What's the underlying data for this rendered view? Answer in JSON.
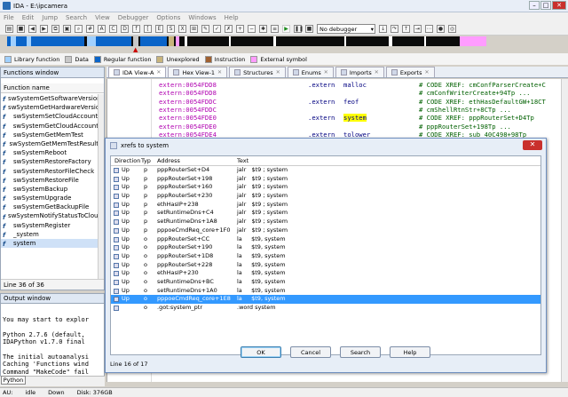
{
  "window": {
    "title": "IDA - E:\\ipcamera"
  },
  "menu": [
    "File",
    "Edit",
    "Jump",
    "Search",
    "View",
    "Debugger",
    "Options",
    "Windows",
    "Help"
  ],
  "toolbar": {
    "debugger_select": "No debugger"
  },
  "legend": [
    {
      "label": "Library function",
      "color": "#a0d0ff"
    },
    {
      "label": "Data",
      "color": "#c8c8c8"
    },
    {
      "label": "Regular function",
      "color": "#0a64c8"
    },
    {
      "label": "Unexplored",
      "color": "#c8b47c"
    },
    {
      "label": "Instruction",
      "color": "#a06030"
    },
    {
      "label": "External symbol",
      "color": "#ff9cff"
    }
  ],
  "functions_window": {
    "title": "Functions window",
    "column": "Function name",
    "items": [
      "swSystemGetSoftwareVersion",
      "swSystemGetHardwareVersion",
      "swSystemSetCloudAccount",
      "swSystemGetCloudAccount",
      "swSystemGetMemTest",
      "swSystemGetMemTestResult",
      "swSystemReboot",
      "swSystemRestoreFactory",
      "swSystemRestorFileCheck",
      "swSystemRestoreFile",
      "swSystemBackup",
      "swSystemUpgrade",
      "swSystemGetBackupFile",
      "swSystemNotifyStatusToCloud",
      "swSystemRegister",
      "_system",
      "system"
    ],
    "status": "Line 36 of 36"
  },
  "output_window": {
    "title": "Output window",
    "lines": [
      "You may start to explor",
      "",
      "Python 2.7.6 (default,",
      "IDAPython v1.7.0 final",
      "",
      "The initial autoanalysi",
      "Caching 'Functions wind",
      "Command \"MakeCode\" fail"
    ],
    "python_button": "Python"
  },
  "tabs": [
    "IDA View-A",
    "Hex View-1",
    "Structures",
    "Enums",
    "Imports",
    "Exports"
  ],
  "disasm": [
    {
      "addr": "extern:0054FDD8",
      "ins": ".extern",
      "op": "malloc",
      "comment": "# CODE XREF: cmConfParserCreate+C"
    },
    {
      "addr": "extern:0054FDD8",
      "ins": "",
      "op": "",
      "comment": "# cmConfWriterCreate+94Tp ..."
    },
    {
      "addr": "extern:0054FDDC",
      "ins": ".extern",
      "op": "feof",
      "comment": "# CODE XREF: ethHasDefaultGW+18CT"
    },
    {
      "addr": "extern:0054FDDC",
      "ins": "",
      "op": "",
      "comment": "# cmShellRtnStr+8CTp ..."
    },
    {
      "addr": "extern:0054FDE0",
      "ins": ".extern",
      "op": "system",
      "comment": "# CODE XREF: pppRouterSet+D4Tp"
    },
    {
      "addr": "extern:0054FDE0",
      "ins": "",
      "op": "",
      "comment": "# pppRouterSet+198Tp ..."
    },
    {
      "addr": "extern:0054FDE4",
      "ins": ".extern",
      "op": "tolower",
      "comment": "# CODE XREF: sub_40C498+98Tp"
    }
  ],
  "xrefs_dialog": {
    "title": "xrefs to system",
    "columns": [
      "Direction",
      "Typ",
      "Address",
      "Text"
    ],
    "rows": [
      {
        "dir": "Up",
        "typ": "p",
        "addr": "pppRouterSet+D4",
        "text": "jalr   $t9 ; system"
      },
      {
        "dir": "Up",
        "typ": "p",
        "addr": "pppRouterSet+198",
        "text": "jalr   $t9 ; system"
      },
      {
        "dir": "Up",
        "typ": "p",
        "addr": "pppRouterSet+160",
        "text": "jalr   $t9 ; system"
      },
      {
        "dir": "Up",
        "typ": "p",
        "addr": "pppRouterSet+230",
        "text": "jalr   $t9 ; system"
      },
      {
        "dir": "Up",
        "typ": "p",
        "addr": "ethHasIP+238",
        "text": "jalr   $t9 ; system"
      },
      {
        "dir": "Up",
        "typ": "p",
        "addr": "setRuntimeDns+C4",
        "text": "jalr   $t9 ; system"
      },
      {
        "dir": "Up",
        "typ": "p",
        "addr": "setRuntimeDns+1A8",
        "text": "jalr   $t9 ; system"
      },
      {
        "dir": "Up",
        "typ": "p",
        "addr": "pppoeCmdReq_core+1F0",
        "text": "jalr   $t9 ; system"
      },
      {
        "dir": "Up",
        "typ": "o",
        "addr": "pppRouterSet+CC",
        "text": "la     $t9, system"
      },
      {
        "dir": "Up",
        "typ": "o",
        "addr": "pppRouterSet+190",
        "text": "la     $t9, system"
      },
      {
        "dir": "Up",
        "typ": "o",
        "addr": "pppRouterSet+1D8",
        "text": "la     $t9, system"
      },
      {
        "dir": "Up",
        "typ": "o",
        "addr": "pppRouterSet+228",
        "text": "la     $t9, system"
      },
      {
        "dir": "Up",
        "typ": "o",
        "addr": "ethHasIP+230",
        "text": "la     $t9, system"
      },
      {
        "dir": "Up",
        "typ": "o",
        "addr": "setRuntimeDns+BC",
        "text": "la     $t9, system"
      },
      {
        "dir": "Up",
        "typ": "o",
        "addr": "setRuntimeDns+1A0",
        "text": "la     $t9, system"
      },
      {
        "dir": "Up",
        "typ": "o",
        "addr": "pppoeCmdReq_core+1E8",
        "text": "la     $t9, system"
      },
      {
        "dir": "",
        "typ": "o",
        "addr": ".got:system_ptr",
        "text": ".word system"
      }
    ],
    "selected_index": 15,
    "buttons": {
      "ok": "OK",
      "cancel": "Cancel",
      "search": "Search",
      "help": "Help"
    },
    "status": "Line 16 of 17"
  },
  "statusbar": {
    "au": "AU:",
    "state": "idle",
    "dir": "Down",
    "disk": "Disk: 376GB"
  }
}
